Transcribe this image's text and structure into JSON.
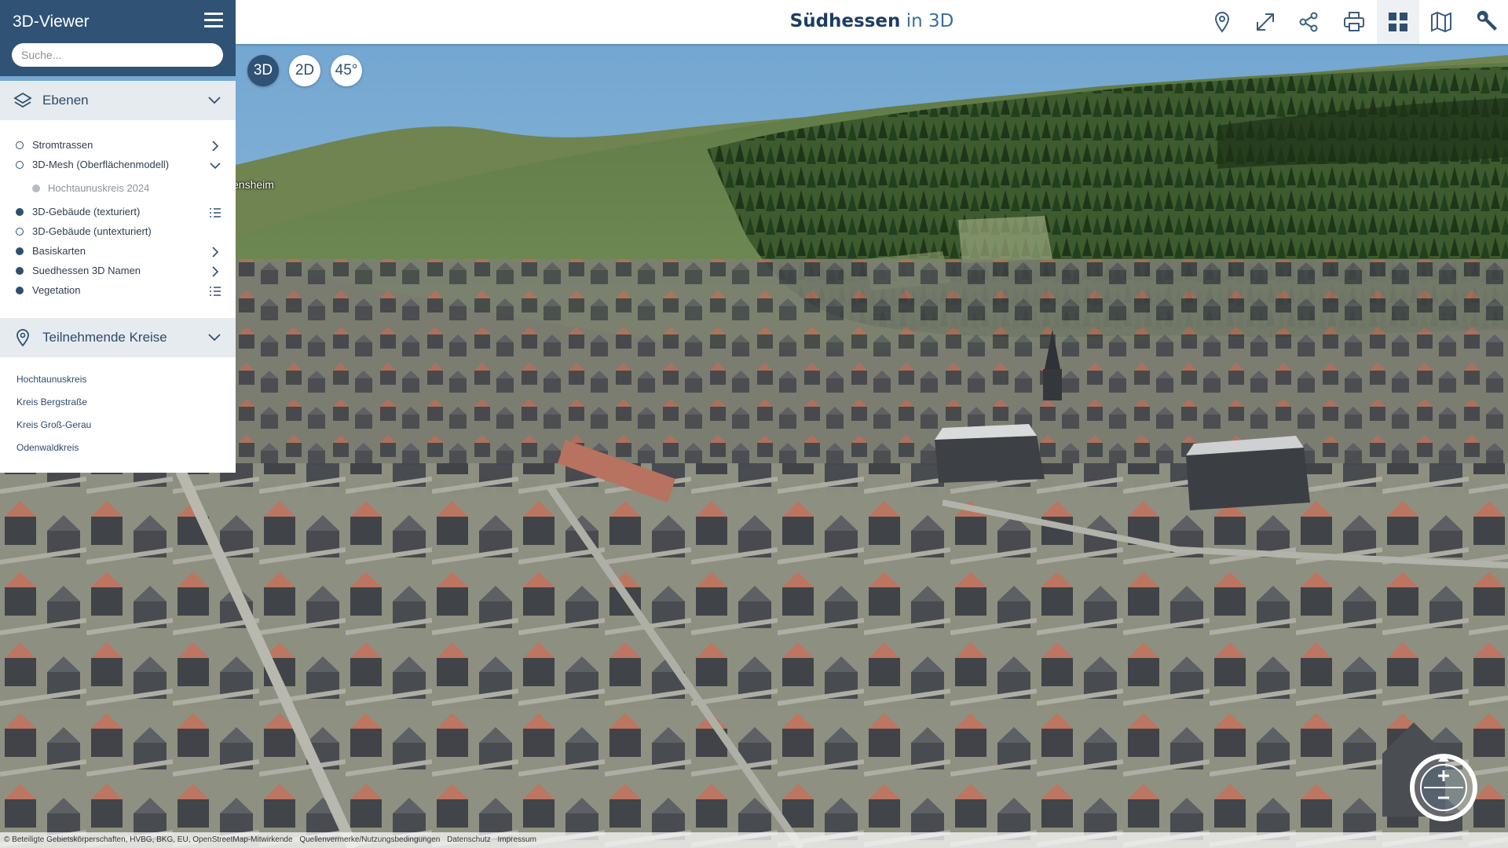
{
  "sidebar": {
    "title": "3D-Viewer",
    "search_placeholder": "Suche...",
    "layers_header": "Ebenen",
    "layers": [
      {
        "label": "Stromtrassen",
        "state": "off",
        "action": "chevron-right"
      },
      {
        "label": "3D-Mesh (Oberflächenmodell)",
        "state": "off",
        "action": "chevron-down"
      },
      {
        "label": "Hochtaunuskreis 2024",
        "state": "sub",
        "action": "none"
      },
      {
        "label": "3D-Gebäude (texturiert)",
        "state": "on",
        "action": "legend"
      },
      {
        "label": "3D-Gebäude (untexturiert)",
        "state": "off",
        "action": "none"
      },
      {
        "label": "Basiskarten",
        "state": "on",
        "action": "chevron-right"
      },
      {
        "label": "Suedhessen 3D Namen",
        "state": "on",
        "action": "chevron-right"
      },
      {
        "label": "Vegetation",
        "state": "on",
        "action": "legend"
      }
    ],
    "kreise_header": "Teilnehmende Kreise",
    "kreise": [
      "Hochtaunuskreis",
      "Kreis Bergstraße",
      "Kreis Groß-Gerau",
      "Odenwaldkreis"
    ]
  },
  "header": {
    "brand_bold": "Südhessen",
    "brand_light": "in 3D",
    "tools": [
      "location-pin-icon",
      "fullscreen-icon",
      "share-icon",
      "print-icon",
      "grid-icon",
      "map-icon",
      "wrench-icon"
    ]
  },
  "view_modes": [
    "3D",
    "2D",
    "45°"
  ],
  "map_label": "ensheim",
  "footer": {
    "attribution": "© Beteiligte Gebietskörperschaften, HVBG, BKG, EU, OpenStreetMap-Mitwirkende",
    "links": [
      "Quellenvermerke/Nutzungsbedingungen",
      "Datenschutz",
      "Impressum"
    ]
  },
  "colors": {
    "primary": "#2f5275",
    "sidebar_section": "#e6ebf0",
    "sky": "#8fb6d4",
    "forest": "#2d4a24",
    "roof": "#b86e58",
    "wall": "#3e4146"
  }
}
